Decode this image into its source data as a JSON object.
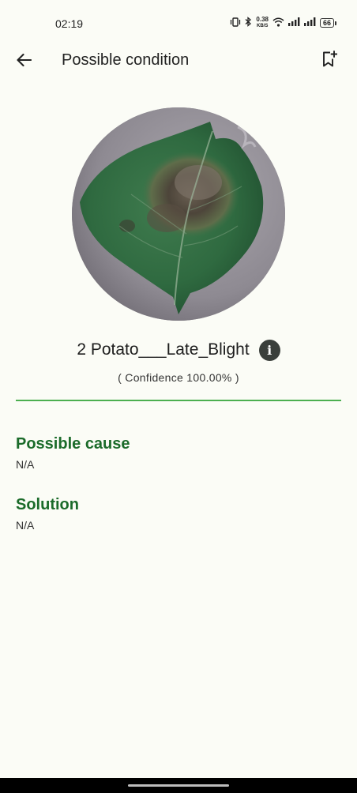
{
  "status_bar": {
    "time": "02:19",
    "net_speed_value": "0.38",
    "net_speed_unit": "KB/S",
    "battery": "66"
  },
  "app_bar": {
    "title": "Possible condition",
    "back_icon": "arrow-left-icon",
    "bookmark_icon": "bookmark-add-icon"
  },
  "result": {
    "image_subject": "leaf-photo",
    "disease_name": "2 Potato___Late_Blight",
    "confidence": "( Confidence 100.00% )"
  },
  "sections": {
    "cause_title": "Possible cause",
    "cause_value": "N/A",
    "solution_title": "Solution",
    "solution_value": "N/A"
  },
  "colors": {
    "accent": "#4caf50",
    "heading_green": "#1b6b2a",
    "background": "#fbfcf6"
  }
}
